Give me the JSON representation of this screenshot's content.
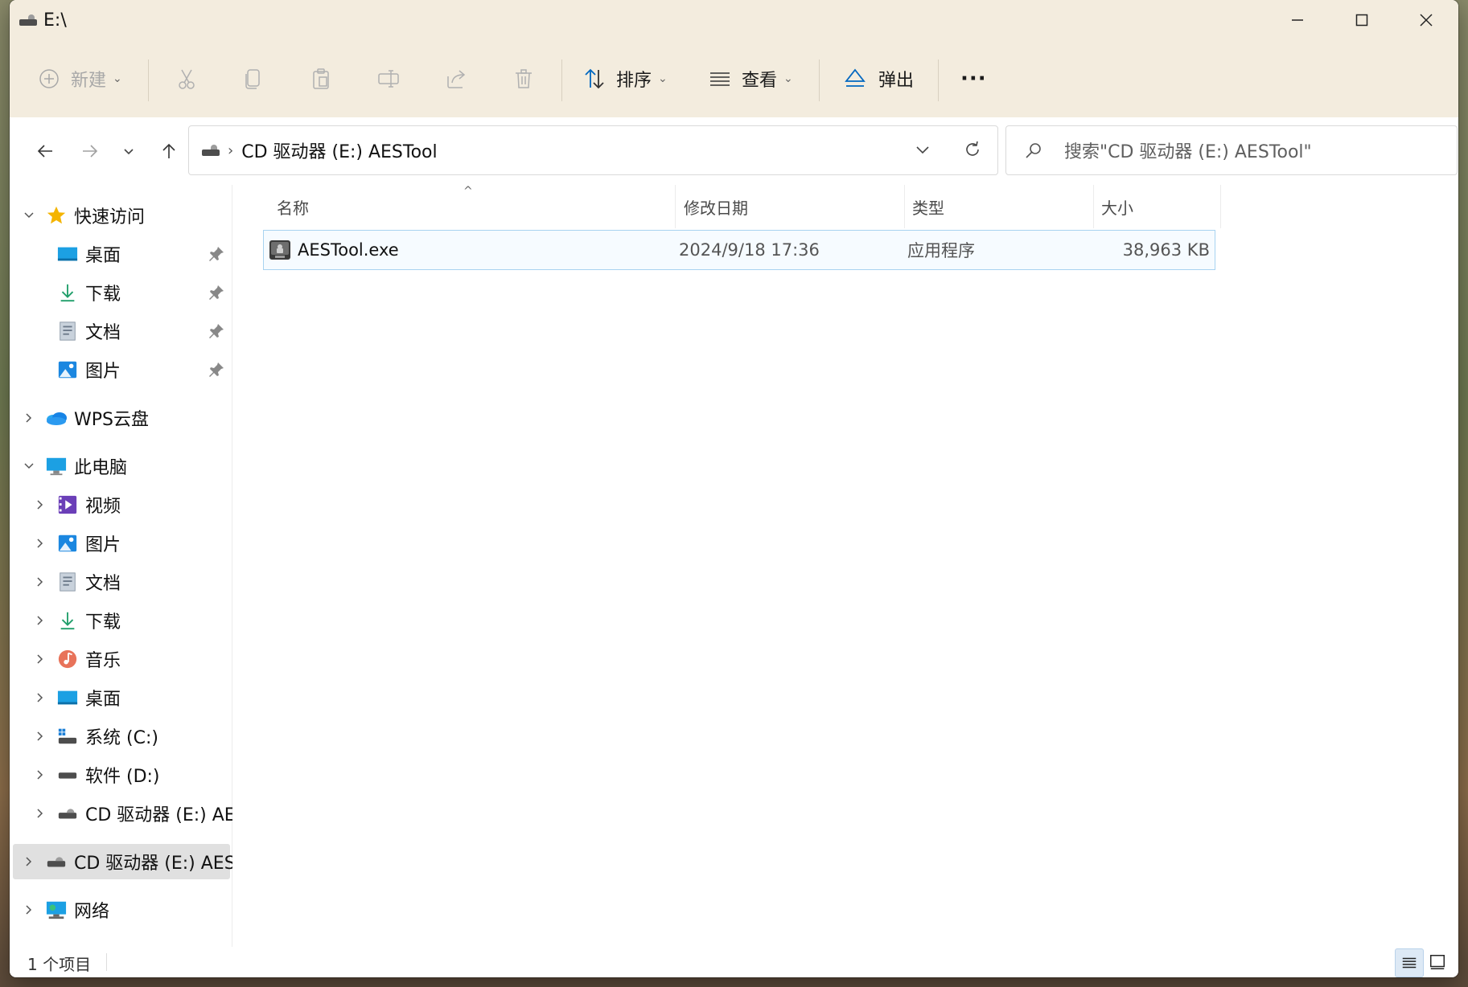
{
  "window": {
    "title": "E:\\"
  },
  "toolbar": {
    "new_label": "新建",
    "sort_label": "排序",
    "view_label": "查看",
    "eject_label": "弹出",
    "more_label": "···"
  },
  "address": {
    "breadcrumb_separator": "›",
    "path_text": "CD 驱动器 (E:) AESTool",
    "search_placeholder": "搜索\"CD 驱动器 (E:) AESTool\""
  },
  "sidebar": {
    "items": [
      {
        "label": "快速访问",
        "icon": "star-icon"
      },
      {
        "label": "桌面",
        "icon": "desktop-icon",
        "pinned": true
      },
      {
        "label": "下载",
        "icon": "download-icon",
        "pinned": true
      },
      {
        "label": "文档",
        "icon": "document-icon",
        "pinned": true
      },
      {
        "label": "图片",
        "icon": "picture-icon",
        "pinned": true
      },
      {
        "label": "WPS云盘",
        "icon": "cloud-icon"
      },
      {
        "label": "此电脑",
        "icon": "computer-icon"
      },
      {
        "label": "视频",
        "icon": "video-icon"
      },
      {
        "label": "图片",
        "icon": "picture-icon"
      },
      {
        "label": "文档",
        "icon": "document-icon"
      },
      {
        "label": "下载",
        "icon": "download-icon"
      },
      {
        "label": "音乐",
        "icon": "music-icon"
      },
      {
        "label": "桌面",
        "icon": "desktop-icon"
      },
      {
        "label": "系统 (C:)",
        "icon": "system-drive-icon"
      },
      {
        "label": "软件 (D:)",
        "icon": "drive-icon"
      },
      {
        "label": "CD 驱动器 (E:) AES",
        "icon": "cd-drive-icon"
      },
      {
        "label": "CD 驱动器 (E:) AEST",
        "icon": "cd-drive-icon",
        "selected": true
      },
      {
        "label": "网络",
        "icon": "network-icon"
      }
    ]
  },
  "columns": {
    "name": "名称",
    "modified": "修改日期",
    "type": "类型",
    "size": "大小"
  },
  "files": [
    {
      "name": "AESTool.exe",
      "modified": "2024/9/18 17:36",
      "type": "应用程序",
      "size": "38,963 KB"
    }
  ],
  "status": {
    "item_count": "1 个项目"
  },
  "colors": {
    "titlebar_bg": "#f3ecde",
    "selection_border": "#a8d3f0",
    "accent": "#0067c0"
  }
}
